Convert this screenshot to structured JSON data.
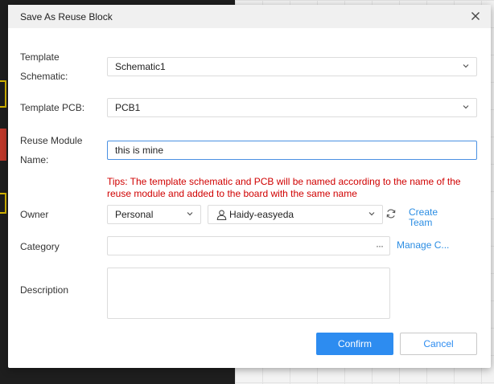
{
  "dialog": {
    "title": "Save As Reuse Block"
  },
  "form": {
    "template_schematic": {
      "label_line1": "Template",
      "label_line2": "Schematic:",
      "value": "Schematic1"
    },
    "template_pcb": {
      "label": "Template PCB:",
      "value": "PCB1"
    },
    "reuse_module_name": {
      "label_line1": "Reuse Module",
      "label_line2": "Name:",
      "value": "this is mine"
    },
    "tips": "Tips: The template schematic and PCB will be named according to the name of the reuse module and added to the board with the same name",
    "owner": {
      "label": "Owner",
      "type_value": "Personal",
      "user_value": "Haidy-easyeda",
      "create_team_line1": "Create",
      "create_team_line2": "Team"
    },
    "category": {
      "label": "Category",
      "value": "",
      "more_glyph": "···",
      "manage_label": "Manage C..."
    },
    "description": {
      "label": "Description",
      "value": ""
    }
  },
  "buttons": {
    "confirm": "Confirm",
    "cancel": "Cancel"
  },
  "colors": {
    "primary": "#2d8cf0",
    "link": "#2b8de3",
    "tips": "#d00000",
    "active_border": "#4a90e2"
  },
  "icons": {
    "close": "close-icon",
    "dropdown": "chevron-down-icon",
    "user": "user-icon",
    "refresh": "refresh-icon"
  }
}
